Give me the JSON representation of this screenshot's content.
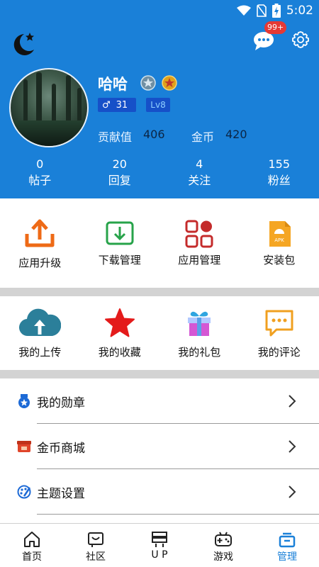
{
  "status_bar": {
    "time": "5:02"
  },
  "header": {
    "message_badge": "99+",
    "username": "哈哈",
    "gender_age": "31",
    "level": "Lv8",
    "contribution_label": "贡献值",
    "contribution_value": "406",
    "coins_label": "金币",
    "coins_value": "420"
  },
  "counts": [
    {
      "value": "0",
      "label": "帖子"
    },
    {
      "value": "20",
      "label": "回复"
    },
    {
      "value": "4",
      "label": "关注"
    },
    {
      "value": "155",
      "label": "粉丝"
    }
  ],
  "grid_row_1": [
    {
      "label": "应用升级",
      "icon": "upload-tray-icon"
    },
    {
      "label": "下载管理",
      "icon": "download-tray-icon"
    },
    {
      "label": "应用管理",
      "icon": "apps-grid-icon"
    },
    {
      "label": "安装包",
      "icon": "apk-icon"
    }
  ],
  "grid_row_2": [
    {
      "label": "我的上传",
      "icon": "cloud-upload-icon"
    },
    {
      "label": "我的收藏",
      "icon": "star-icon"
    },
    {
      "label": "我的礼包",
      "icon": "gift-icon"
    },
    {
      "label": "我的评论",
      "icon": "comment-icon"
    }
  ],
  "menu": [
    {
      "label": "我的勋章",
      "icon": "medal-icon"
    },
    {
      "label": "金币商城",
      "icon": "store-icon"
    },
    {
      "label": "主题设置",
      "icon": "palette-icon"
    }
  ],
  "bottom_nav": [
    {
      "label": "首页",
      "icon": "home-icon"
    },
    {
      "label": "社区",
      "icon": "community-icon"
    },
    {
      "label": "U P",
      "icon": "up-icon"
    },
    {
      "label": "游戏",
      "icon": "gamepad-icon"
    },
    {
      "label": "管理",
      "icon": "manage-icon",
      "active": true
    }
  ],
  "colors": {
    "header_bg": "#1a80d8",
    "active_tab": "#1a80d8",
    "separator": "#d3d3d3",
    "badge": "#e53935"
  }
}
